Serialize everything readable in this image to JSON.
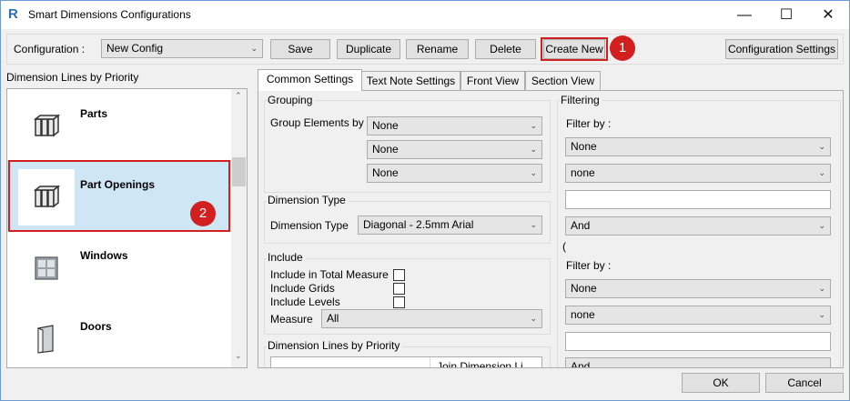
{
  "window": {
    "title": "Smart Dimensions Configurations",
    "app_icon": "R",
    "minimize": "—",
    "maximize": "☐",
    "close": "✕"
  },
  "toolbar": {
    "configuration_label": "Configuration   :",
    "configuration_value": "New Config",
    "save": "Save",
    "duplicate": "Duplicate",
    "rename": "Rename",
    "delete": "Delete",
    "create_new": "Create New",
    "configuration_settings": "Configuration Settings"
  },
  "annotations": {
    "badge_1": "1",
    "badge_2": "2"
  },
  "left_panel": {
    "title": "Dimension Lines by Priority",
    "items": [
      {
        "name": "Parts",
        "icon": "parts-icon"
      },
      {
        "name": "Part Openings",
        "icon": "part-openings-icon"
      },
      {
        "name": "Windows",
        "icon": "window-icon"
      },
      {
        "name": "Doors",
        "icon": "door-icon"
      }
    ]
  },
  "tabs": [
    "Common Settings",
    "Text Note Settings",
    "Front View",
    "Section View"
  ],
  "grouping": {
    "title": "Grouping",
    "label": "Group Elements by",
    "values": [
      "None",
      "None",
      "None"
    ]
  },
  "dimension_type": {
    "title": "Dimension Type",
    "label": "Dimension Type",
    "value": "Diagonal - 2.5mm Arial"
  },
  "include": {
    "title": "Include",
    "total_measure": "Include in Total Measure",
    "grids": "Include Grids",
    "levels": "Include Levels",
    "measure_label": "Measure",
    "measure_value": "All"
  },
  "priority_section": {
    "title": "Dimension Lines by Priority",
    "col2": "Join Dimension Li"
  },
  "filtering": {
    "title": "Filtering",
    "filter1_label": "Filter by :",
    "filter1_value": "None",
    "filter1_op": "none",
    "logic1": "And",
    "paren": "(",
    "filter2_label": "Filter by :",
    "filter2_value": "None",
    "filter2_op": "none",
    "logic2": "And"
  },
  "footer": {
    "ok": "OK",
    "cancel": "Cancel"
  }
}
